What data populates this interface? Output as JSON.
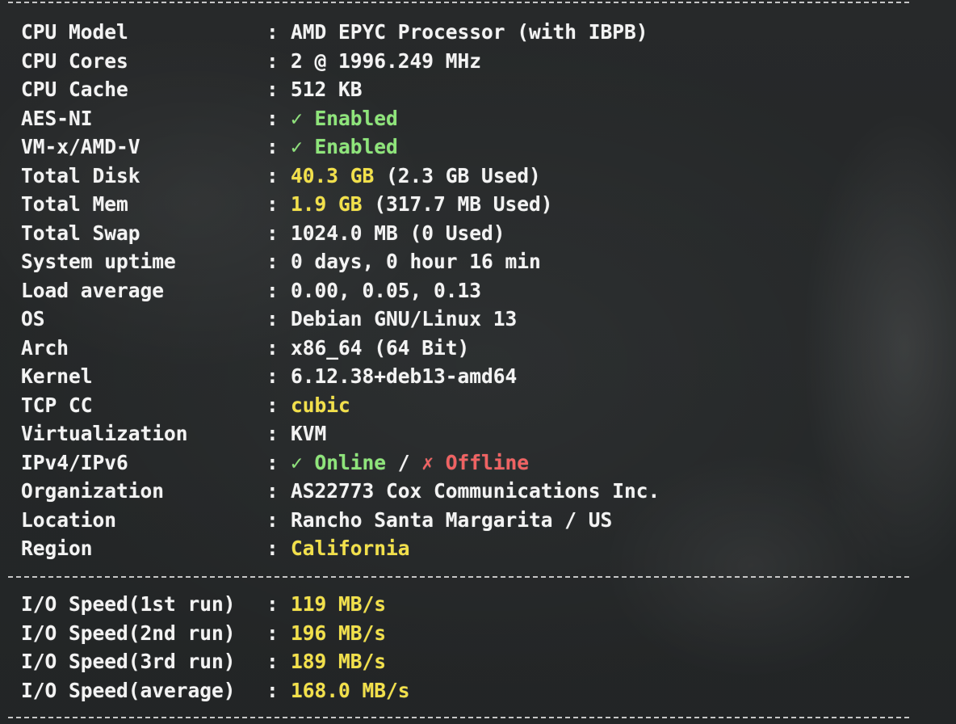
{
  "system_info": [
    {
      "label": "CPU Model",
      "colon": ":",
      "parts": [
        {
          "text": "AMD EPYC Processor (with IBPB)",
          "color": "white"
        }
      ]
    },
    {
      "label": "CPU Cores",
      "colon": ":",
      "parts": [
        {
          "text": "2 @ 1996.249 MHz",
          "color": "white"
        }
      ]
    },
    {
      "label": "CPU Cache",
      "colon": ":",
      "parts": [
        {
          "text": "512 KB",
          "color": "white"
        }
      ]
    },
    {
      "label": "AES-NI",
      "colon": ":",
      "parts": [
        {
          "text": "✓ Enabled",
          "color": "green"
        }
      ]
    },
    {
      "label": "VM-x/AMD-V",
      "colon": ":",
      "parts": [
        {
          "text": "✓ Enabled",
          "color": "green"
        }
      ]
    },
    {
      "label": "Total Disk",
      "colon": ":",
      "parts": [
        {
          "text": "40.3 GB",
          "color": "yellow"
        },
        {
          "text": " (2.3 GB Used)",
          "color": "white"
        }
      ]
    },
    {
      "label": "Total Mem",
      "colon": ":",
      "parts": [
        {
          "text": "1.9 GB",
          "color": "yellow"
        },
        {
          "text": " (317.7 MB Used)",
          "color": "white"
        }
      ]
    },
    {
      "label": "Total Swap",
      "colon": ":",
      "parts": [
        {
          "text": "1024.0 MB (0 Used)",
          "color": "white"
        }
      ]
    },
    {
      "label": "System uptime",
      "colon": ":",
      "parts": [
        {
          "text": "0 days, 0 hour 16 min",
          "color": "white"
        }
      ]
    },
    {
      "label": "Load average",
      "colon": ":",
      "parts": [
        {
          "text": "0.00, 0.05, 0.13",
          "color": "white"
        }
      ]
    },
    {
      "label": "OS",
      "colon": ":",
      "parts": [
        {
          "text": "Debian GNU/Linux 13",
          "color": "white"
        }
      ]
    },
    {
      "label": "Arch",
      "colon": ":",
      "parts": [
        {
          "text": "x86_64 (64 Bit)",
          "color": "white"
        }
      ]
    },
    {
      "label": "Kernel",
      "colon": ":",
      "parts": [
        {
          "text": "6.12.38+deb13-amd64",
          "color": "white"
        }
      ]
    },
    {
      "label": "TCP CC",
      "colon": ":",
      "parts": [
        {
          "text": "cubic",
          "color": "yellow"
        }
      ]
    },
    {
      "label": "Virtualization",
      "colon": ":",
      "parts": [
        {
          "text": "KVM",
          "color": "white"
        }
      ]
    },
    {
      "label": "IPv4/IPv6",
      "colon": ":",
      "parts": [
        {
          "text": "✓ Online",
          "color": "green"
        },
        {
          "text": " / ",
          "color": "white"
        },
        {
          "text": "✗ Offline",
          "color": "red"
        }
      ]
    },
    {
      "label": "Organization",
      "colon": ":",
      "parts": [
        {
          "text": "AS22773 Cox Communications Inc.",
          "color": "white"
        }
      ]
    },
    {
      "label": "Location",
      "colon": ":",
      "parts": [
        {
          "text": "Rancho Santa Margarita / US",
          "color": "white"
        }
      ]
    },
    {
      "label": "Region",
      "colon": ":",
      "parts": [
        {
          "text": "California",
          "color": "yellow"
        }
      ]
    }
  ],
  "io_speed": [
    {
      "label": "I/O Speed(1st run)",
      "colon": ":",
      "parts": [
        {
          "text": "119 MB/s",
          "color": "yellow"
        }
      ]
    },
    {
      "label": "I/O Speed(2nd run)",
      "colon": ":",
      "parts": [
        {
          "text": "196 MB/s",
          "color": "yellow"
        }
      ]
    },
    {
      "label": "I/O Speed(3rd run)",
      "colon": ":",
      "parts": [
        {
          "text": "189 MB/s",
          "color": "yellow"
        }
      ]
    },
    {
      "label": "I/O Speed(average)",
      "colon": ":",
      "parts": [
        {
          "text": "168.0 MB/s",
          "color": "yellow"
        }
      ]
    }
  ],
  "colors": {
    "background": "#2c2f30",
    "text": "#f3f3f3",
    "green": "#8ee57a",
    "yellow": "#f2e04a",
    "red": "#f06262"
  }
}
